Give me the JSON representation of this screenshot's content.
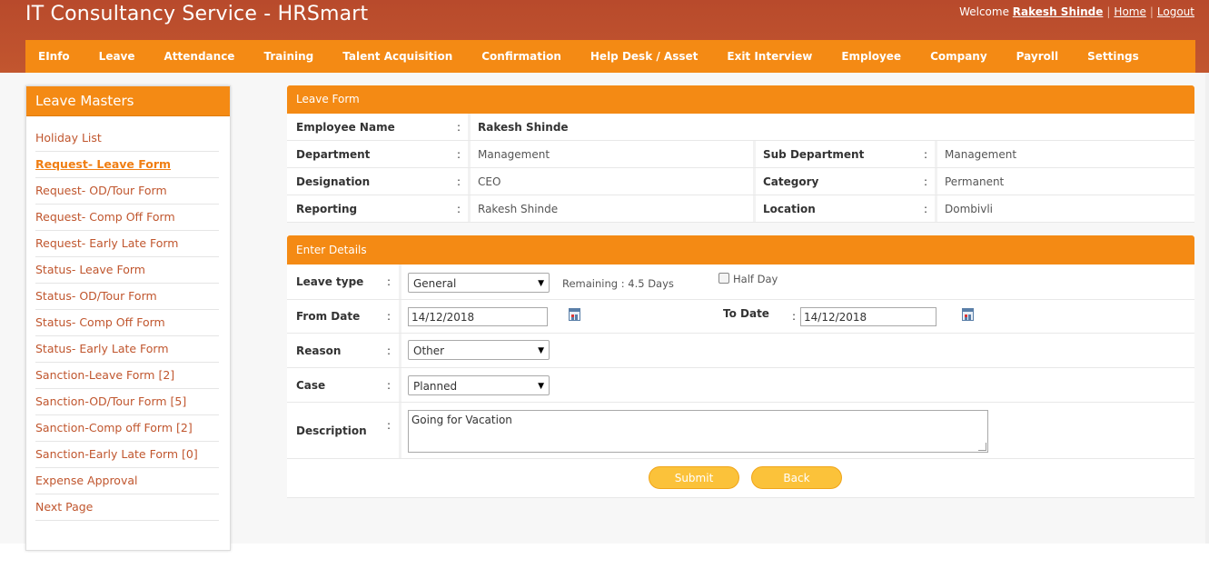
{
  "header": {
    "title": "IT Consultancy Service - HRSmart",
    "welcome_label": "Welcome",
    "user_name": "Rakesh Shinde",
    "home_link": "Home",
    "logout_link": "Logout",
    "separator": "|"
  },
  "nav": {
    "items": [
      "EInfo",
      "Leave",
      "Attendance",
      "Training",
      "Talent Acquisition",
      "Confirmation",
      "Help Desk / Asset",
      "Exit Interview",
      "Employee",
      "Company",
      "Payroll",
      "Settings"
    ]
  },
  "sidebar": {
    "title": "Leave Masters",
    "items": [
      "Holiday List",
      "Request- Leave Form",
      "Request- OD/Tour Form",
      "Request- Comp Off Form",
      "Request- Early Late Form",
      "Status- Leave Form",
      "Status- OD/Tour Form",
      "Status- Comp Off Form",
      "Status- Early Late Form",
      "Sanction-Leave Form [2]",
      "Sanction-OD/Tour Form [5]",
      "Sanction-Comp off Form [2]",
      "Sanction-Early Late Form [0]",
      "Expense Approval",
      "Next Page"
    ],
    "active_index": 1
  },
  "leave_form": {
    "title": "Leave Form",
    "colon": ":",
    "employee_name_label": "Employee Name",
    "employee_name": "Rakesh Shinde",
    "department_label": "Department",
    "department": "Management",
    "sub_department_label": "Sub Department",
    "sub_department": "Management",
    "designation_label": "Designation",
    "designation": "CEO",
    "category_label": "Category",
    "category": "Permanent",
    "reporting_label": "Reporting",
    "reporting": "Rakesh Shinde",
    "location_label": "Location",
    "location": "Dombivli"
  },
  "details": {
    "title": "Enter Details",
    "colon": ":",
    "leave_type_label": "Leave type",
    "leave_type_value": "General",
    "remaining_text": "Remaining : 4.5 Days",
    "half_day_label": "Half Day",
    "half_day_checked": false,
    "from_date_label": "From Date",
    "from_date_value": "14/12/2018",
    "to_date_label": "To Date",
    "to_date_value": "14/12/2018",
    "reason_label": "Reason",
    "reason_value": "Other",
    "case_label": "Case",
    "case_value": "Planned",
    "description_label": "Description",
    "description_value": "Going for Vacation",
    "submit_label": "Submit",
    "back_label": "Back"
  },
  "icons": {
    "calendar": "calendar-icon",
    "dropdown": "chevron-down-icon",
    "arrow_glyph": "▼"
  },
  "colors": {
    "header_bg": "#b84a2c",
    "accent_orange": "#f48a14",
    "button_yellow": "#fbc23a",
    "link_red": "#c0562e"
  }
}
